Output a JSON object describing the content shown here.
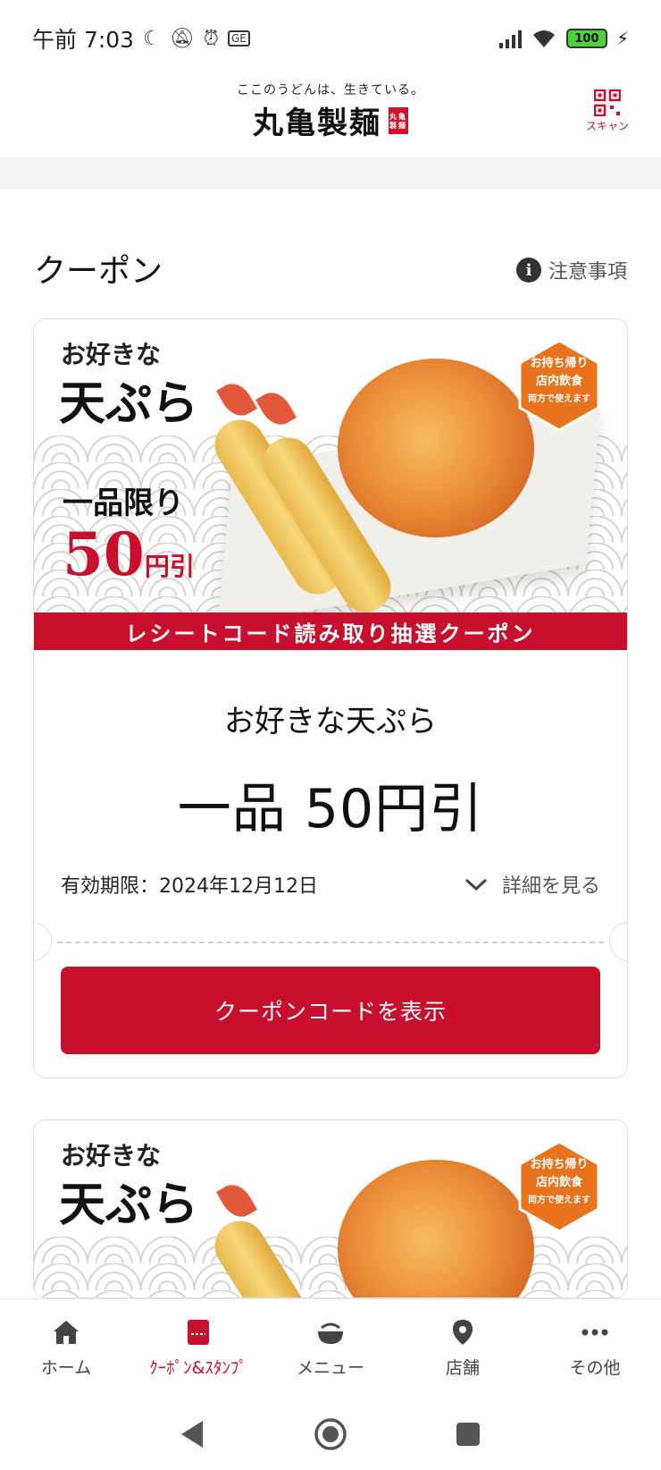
{
  "status_bar": {
    "time": "午前 7:03",
    "battery": "100"
  },
  "header": {
    "tagline": "ここのうどんは、生きている。",
    "brand": "丸亀製麺",
    "seal": "丸亀製麺",
    "scan_label": "スキャン"
  },
  "page": {
    "title": "クーポン",
    "notice_label": "注意事項"
  },
  "coupons": [
    {
      "banner": {
        "line1": "お好きな",
        "line2": "天ぷら",
        "line3": "一品限り",
        "price_num": "50",
        "price_unit": "円引",
        "badge_line1": "お持ち帰り",
        "badge_line2": "店内飲食",
        "badge_line3": "両方で使えます",
        "strip": "レシートコード読み取り抽選クーポン"
      },
      "name": "お好きな天ぷら",
      "value": "一品 50円引",
      "expiry": "有効期限：2024年12月12日",
      "details_label": "詳細を見る",
      "button_label": "クーポンコードを表示"
    },
    {
      "banner": {
        "line1": "お好きな",
        "line2": "天ぷら",
        "badge_line1": "お持ち帰り",
        "badge_line2": "店内飲食",
        "badge_line3": "両方で使えます"
      }
    }
  ],
  "bottom_nav": [
    {
      "label": "ホーム",
      "icon": "home-icon"
    },
    {
      "label": "ｸｰﾎﾟﾝ&ｽﾀﾝﾌﾟ",
      "icon": "coupon-icon",
      "active": true
    },
    {
      "label": "メニュー",
      "icon": "bowl-icon"
    },
    {
      "label": "店舗",
      "icon": "location-pin-icon"
    },
    {
      "label": "その他",
      "icon": "more-icon"
    }
  ],
  "colors": {
    "brand_red": "#c8102e",
    "badge_orange": "#e8731c"
  }
}
